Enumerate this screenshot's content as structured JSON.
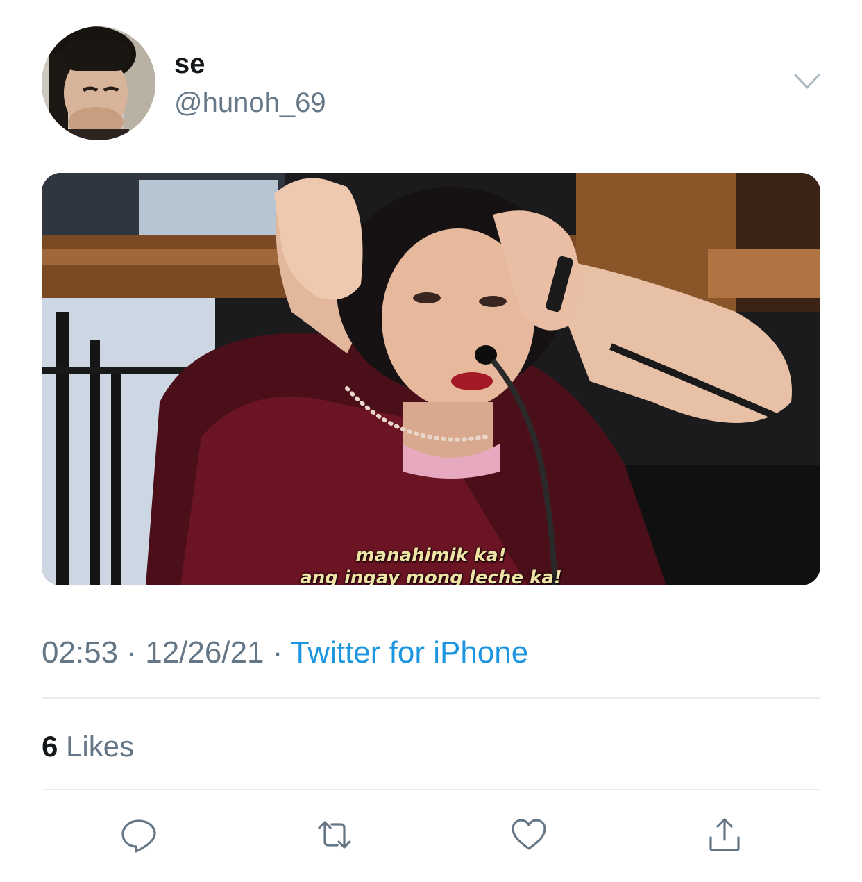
{
  "user": {
    "display_name": "se",
    "handle": "@hunoh_69"
  },
  "media": {
    "subtitle_line1": "manahimik ka!",
    "subtitle_line2": "ang ingay mong leche ka!"
  },
  "meta": {
    "time": "02:53",
    "separator": "·",
    "date": "12/26/21",
    "source": "Twitter for iPhone"
  },
  "stats": {
    "likes_count": "6",
    "likes_label": "Likes"
  },
  "actions": {
    "icons": [
      "reply-icon",
      "retweet-icon",
      "like-icon",
      "share-icon"
    ]
  },
  "colors": {
    "link": "#1b95e0",
    "secondary_text": "#657786",
    "divider": "#e6ecf0"
  }
}
